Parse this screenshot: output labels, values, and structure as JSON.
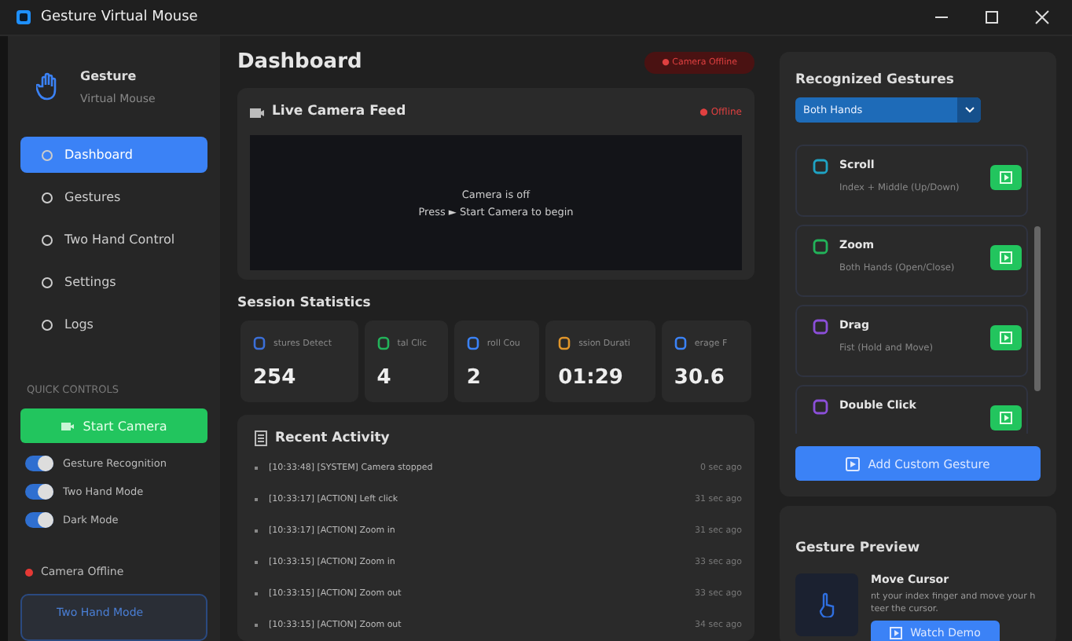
{
  "window": {
    "title": "Gesture Virtual Mouse"
  },
  "sidebar": {
    "app_name": "Gesture",
    "app_subtitle": "Virtual Mouse",
    "items": [
      {
        "label": "Dashboard",
        "selected": true
      },
      {
        "label": "Gestures",
        "selected": false
      },
      {
        "label": "Two Hand Control",
        "selected": false
      },
      {
        "label": "Settings",
        "selected": false
      },
      {
        "label": "Logs",
        "selected": false
      }
    ],
    "quick_controls_label": "QUICK CONTROLS",
    "start_button": "Start Camera",
    "toggles": [
      {
        "label": "Gesture Recognition",
        "on": true
      },
      {
        "label": "Two Hand Mode",
        "on": true
      },
      {
        "label": "Dark Mode",
        "on": true
      }
    ],
    "camera_status": "Camera Offline",
    "mode_card": "Two Hand Mode"
  },
  "main": {
    "title": "Dashboard",
    "status_badge": "● Camera Offline",
    "camera": {
      "title": "Live Camera Feed",
      "status": "● Offline",
      "message": "Camera is off",
      "hint": "Press ► Start Camera to begin"
    },
    "stats_title": "Session Statistics",
    "stats": [
      {
        "label": "stures Detect",
        "value": "254",
        "color": "#3b6fd8"
      },
      {
        "label": "tal Clic",
        "value": "4",
        "color": "#22b35a"
      },
      {
        "label": "roll Cou",
        "value": "2",
        "color": "#3b82f6"
      },
      {
        "label": "ssion Durati",
        "value": "01:29",
        "color": "#e0952a"
      },
      {
        "label": "erage F",
        "value": "30.6",
        "color": "#3b82f6"
      }
    ],
    "activity_title": "Recent Activity",
    "activity": [
      {
        "text": "[10:33:48] [SYSTEM] Camera stopped",
        "time": "0 sec ago"
      },
      {
        "text": "[10:33:17] [ACTION] Left click",
        "time": "31 sec ago"
      },
      {
        "text": "[10:33:17] [ACTION] Zoom in",
        "time": "31 sec ago"
      },
      {
        "text": "[10:33:15] [ACTION] Zoom in",
        "time": "33 sec ago"
      },
      {
        "text": "[10:33:15] [ACTION] Zoom out",
        "time": "33 sec ago"
      },
      {
        "text": "[10:33:15] [ACTION] Zoom out",
        "time": "34 sec ago"
      }
    ]
  },
  "gestures_panel": {
    "title": "Recognized Gestures",
    "filter": "Both Hands",
    "items": [
      {
        "name": "Scroll",
        "description": "Index + Middle (Up/Down)",
        "color": "#1fa3c4"
      },
      {
        "name": "Zoom",
        "description": "Both Hands (Open/Close)",
        "color": "#22b35a"
      },
      {
        "name": "Drag",
        "description": "Fist (Hold and Move)",
        "color": "#8b4fd8"
      },
      {
        "name": "Double Click",
        "color": "#8b4fd8"
      }
    ],
    "add_button": "Add Custom Gesture"
  },
  "preview": {
    "title": "Gesture Preview",
    "gesture": "Move Cursor",
    "description_lines": [
      "nt your index finger and move your h",
      "teer the cursor."
    ],
    "button": "Watch Demo"
  }
}
